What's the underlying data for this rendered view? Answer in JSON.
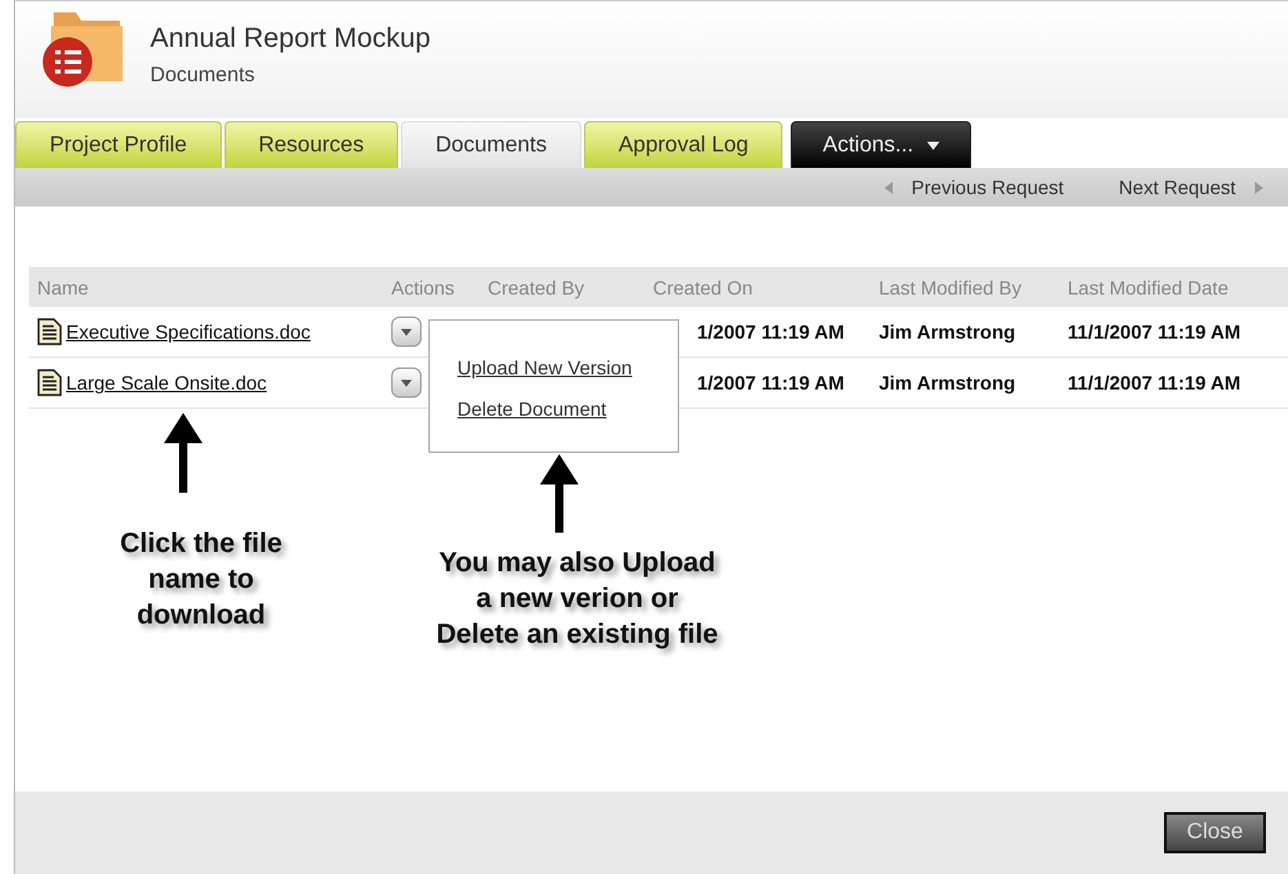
{
  "header": {
    "title": "Annual Report Mockup",
    "subtitle": "Documents"
  },
  "tabs": [
    {
      "label": "Project Profile",
      "kind": "tab",
      "selected": false
    },
    {
      "label": "Resources",
      "kind": "tab",
      "selected": false
    },
    {
      "label": "Documents",
      "kind": "tab",
      "selected": true
    },
    {
      "label": "Approval Log",
      "kind": "tab",
      "selected": false
    },
    {
      "label": "Actions...",
      "kind": "menu",
      "selected": false
    }
  ],
  "nav": {
    "previous": "Previous Request",
    "next": "Next Request"
  },
  "table": {
    "columns": [
      "Name",
      "Actions",
      "Created By",
      "Created On",
      "Last Modified By",
      "Last Modified Date"
    ],
    "rows": [
      {
        "name": "Executive Specifications.doc",
        "created_on": "1/2007 11:19 AM",
        "last_modified_by": "Jim Armstrong",
        "last_modified_date": "11/1/2007 11:19 AM"
      },
      {
        "name": "Large Scale Onsite.doc",
        "created_on": "1/2007 11:19 AM",
        "last_modified_by": "Jim Armstrong",
        "last_modified_date": "11/1/2007 11:19 AM"
      }
    ]
  },
  "menu": {
    "items": [
      "Upload New Version",
      "Delete Document"
    ]
  },
  "annotations": [
    "Click the file name to download",
    "You may also Upload a new verion or Delete an existing file"
  ],
  "footer": {
    "button": "Close"
  }
}
